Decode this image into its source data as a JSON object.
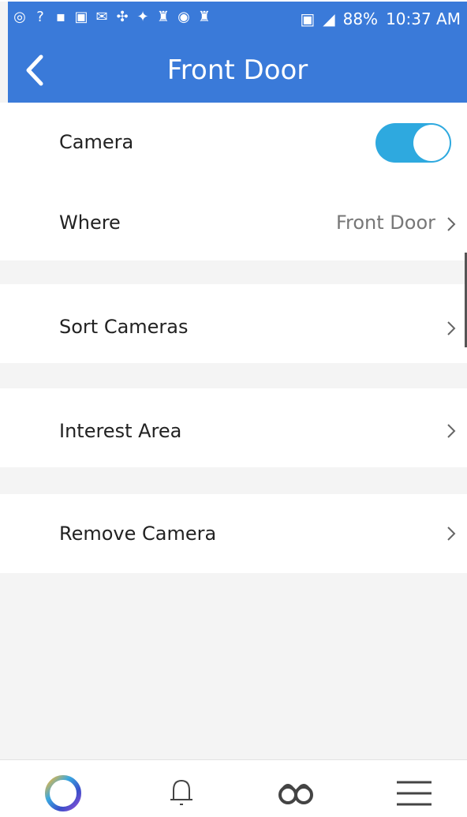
{
  "status_bar": {
    "battery": "88%",
    "time": "10:37 AM",
    "left_icons": [
      "whatsapp-icon",
      "help-icon",
      "bluetooth-icon",
      "image-icon",
      "mail-icon",
      "pinwheel-icon",
      "spark-icon",
      "person-icon",
      "messenger-icon",
      "person-icon"
    ]
  },
  "header": {
    "title": "Front Door"
  },
  "settings": {
    "camera": {
      "label": "Camera",
      "enabled": true
    },
    "where": {
      "label": "Where",
      "value": "Front Door"
    },
    "sort": {
      "label": "Sort Cameras"
    },
    "interest": {
      "label": "Interest Area"
    },
    "remove": {
      "label": "Remove Camera"
    }
  },
  "colors": {
    "header": "#3a7ad9",
    "toggle_on": "#2ea9df",
    "background": "#f4f4f4"
  },
  "bottom_nav": [
    "home-ring-icon",
    "bell-icon",
    "binoculars-icon",
    "menu-icon"
  ]
}
